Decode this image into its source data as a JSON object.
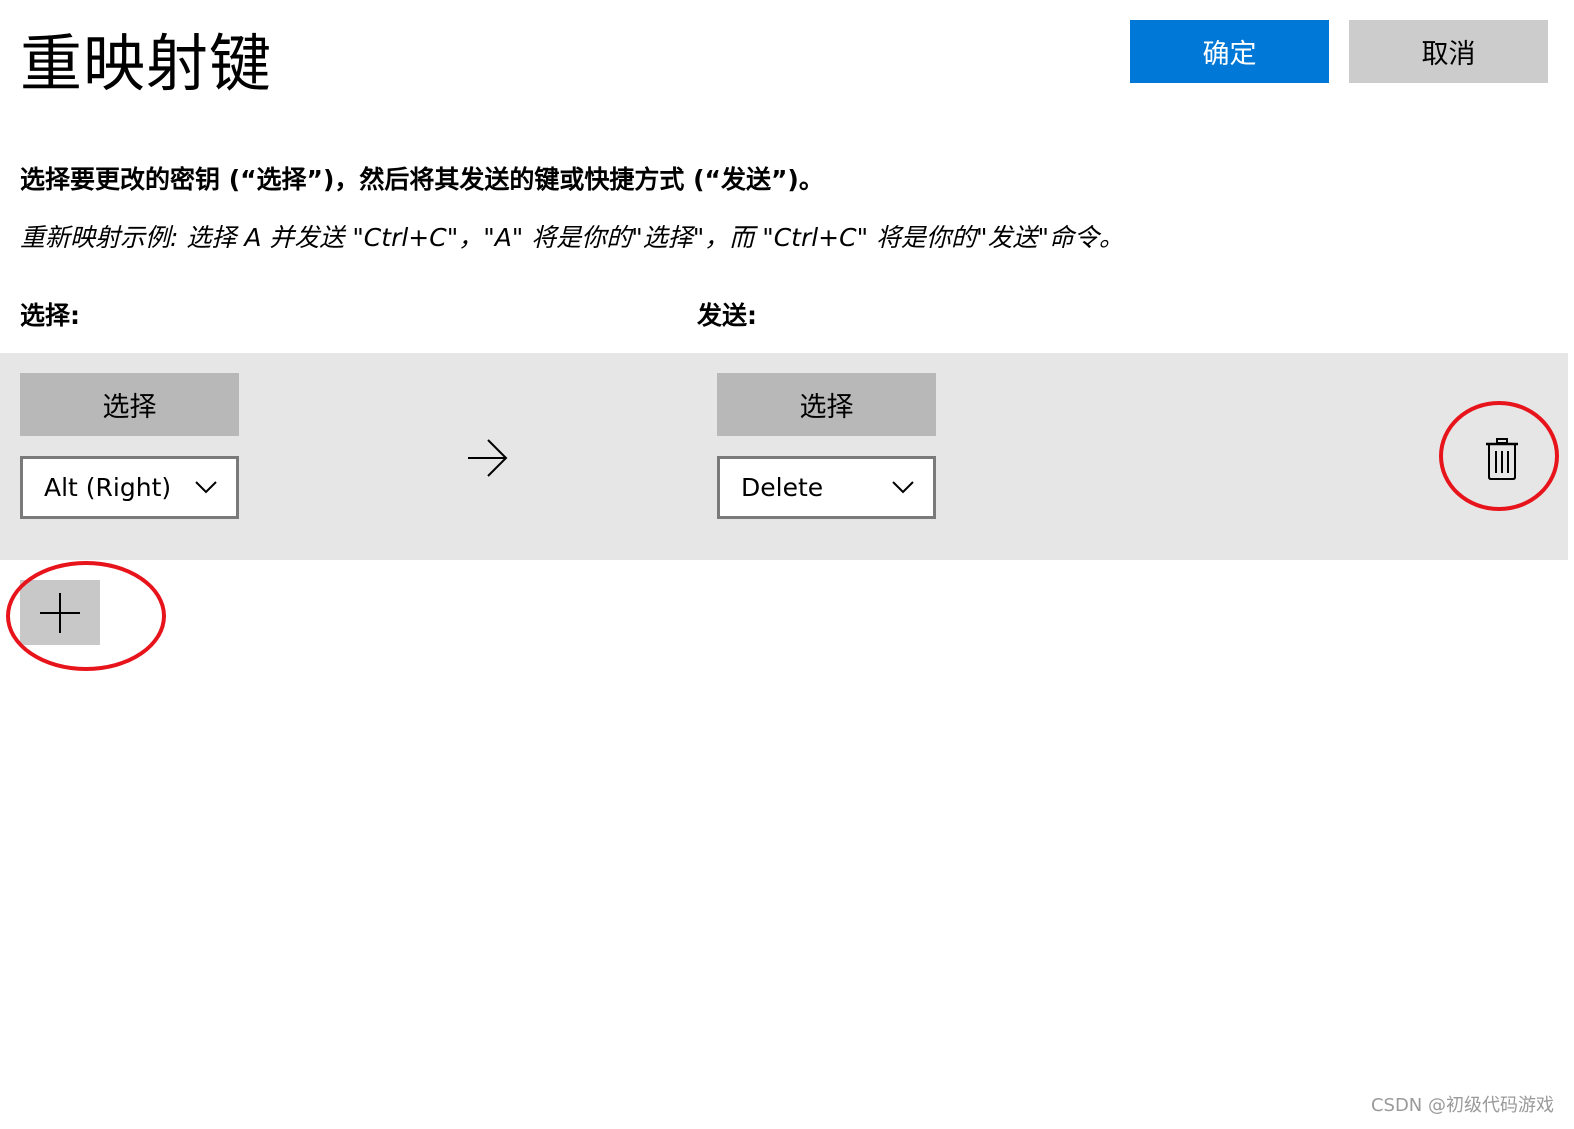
{
  "header": {
    "title": "重映射键",
    "ok_label": "确定",
    "cancel_label": "取消"
  },
  "instructions": {
    "main": "选择要更改的密钥 (“选择”)，然后将其发送的键或快捷方式 (“发送”)。",
    "example": "重新映射示例: 选择 A 并发送 \"Ctrl+C\"，\"A\" 将是你的\"选择\"，而 \"Ctrl+C\" 将是你的\"发送\"命令。"
  },
  "columns": {
    "select_label": "选择:",
    "send_label": "发送:"
  },
  "mapping": {
    "select_button_label": "选择",
    "select_value": "Alt (Right)",
    "send_button_label": "选择",
    "send_value": "Delete"
  },
  "icons": {
    "arrow": "arrow-right-icon",
    "delete": "trash-icon",
    "add": "plus-icon",
    "dropdown": "chevron-down-icon"
  },
  "colors": {
    "accent": "#0078d7",
    "annotation": "#e8141c"
  },
  "watermark": "CSDN @初级代码游戏"
}
